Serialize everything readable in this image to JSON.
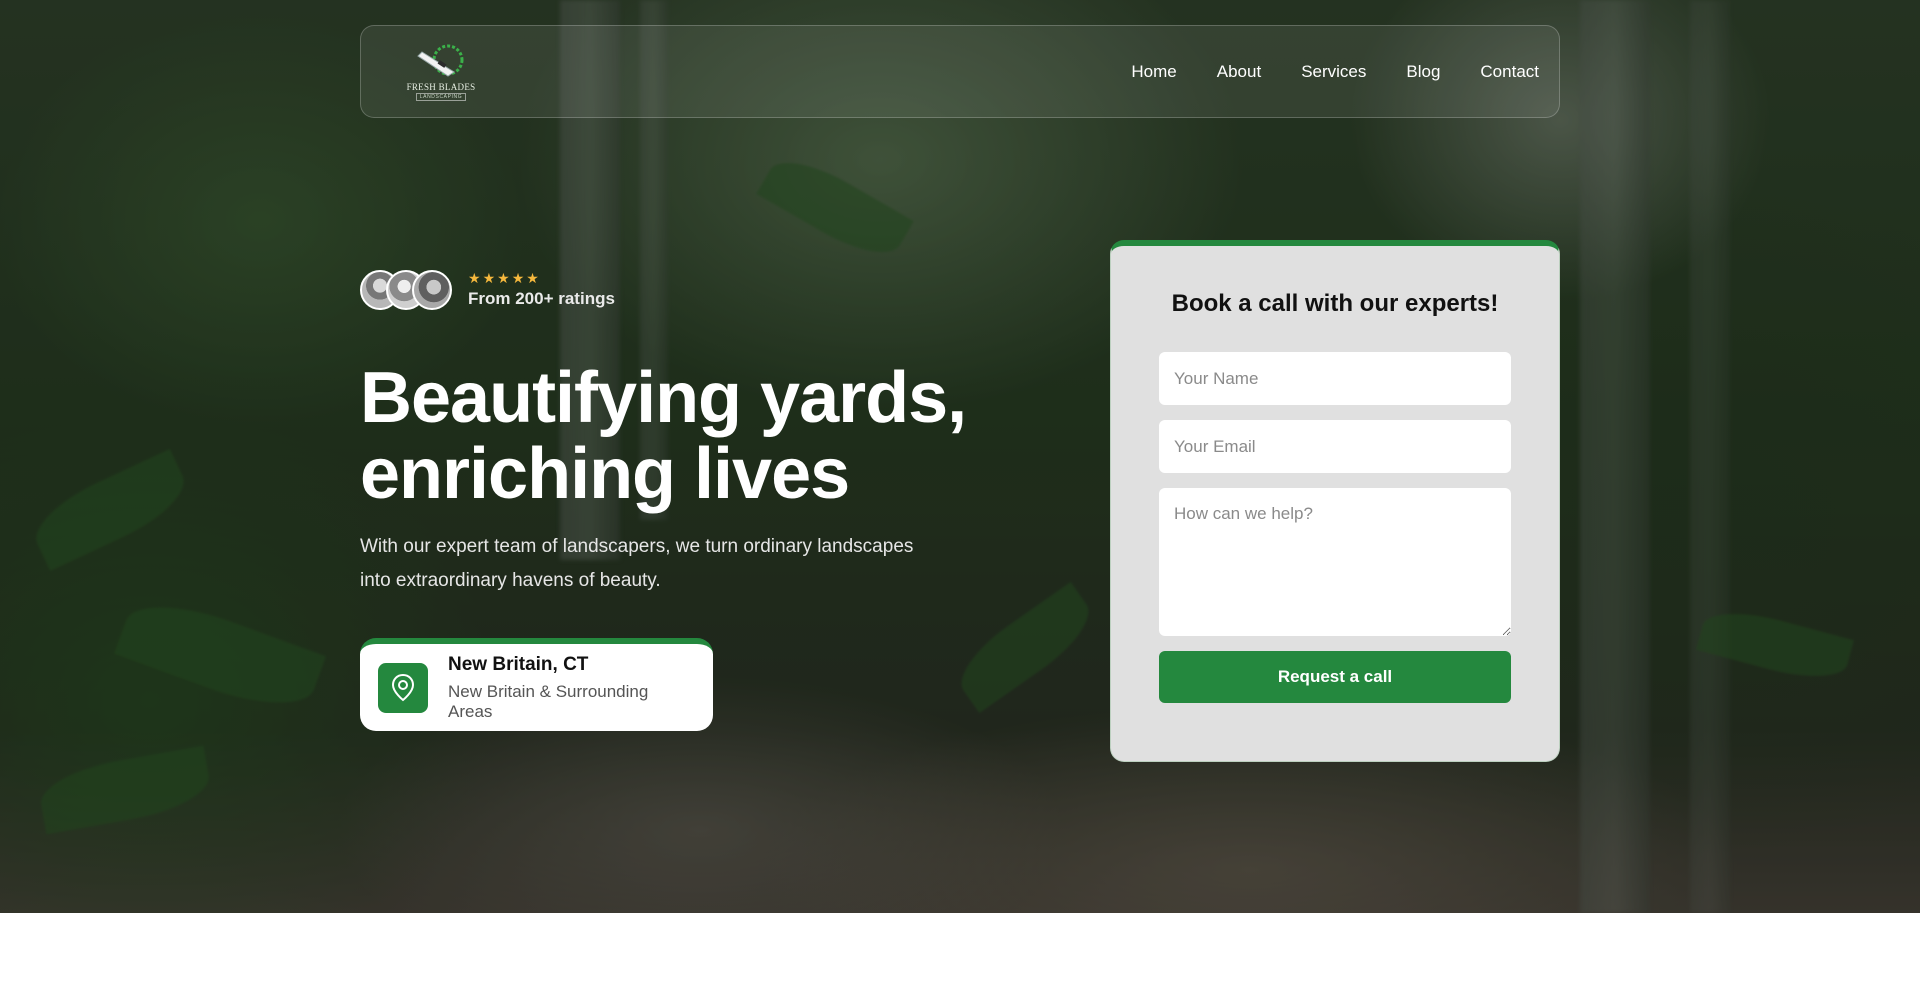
{
  "brand": {
    "logo_name": "FRESH BLADES",
    "logo_tagline": "LANDSCAPING",
    "accent_color": "#24883e",
    "star_color": "#f5b83d"
  },
  "nav": {
    "links": [
      {
        "label": "Home"
      },
      {
        "label": "About"
      },
      {
        "label": "Services"
      },
      {
        "label": "Blog"
      },
      {
        "label": "Contact"
      }
    ]
  },
  "hero": {
    "rating_stars": 5,
    "ratings_text": "From 200+ ratings",
    "headline_line1": "Beautifying yards,",
    "headline_line2": "enriching lives",
    "subtext": "With our expert team of landscapers, we turn ordinary landscapes into extraordinary havens of beauty.",
    "location": {
      "title": "New Britain, CT",
      "subtitle": "New Britain & Surrounding Areas",
      "icon": "map-pin-icon"
    }
  },
  "form": {
    "title": "Book a call with our experts!",
    "name_placeholder": "Your Name",
    "email_placeholder": "Your Email",
    "message_placeholder": "How can we help?",
    "submit_label": "Request a call"
  }
}
